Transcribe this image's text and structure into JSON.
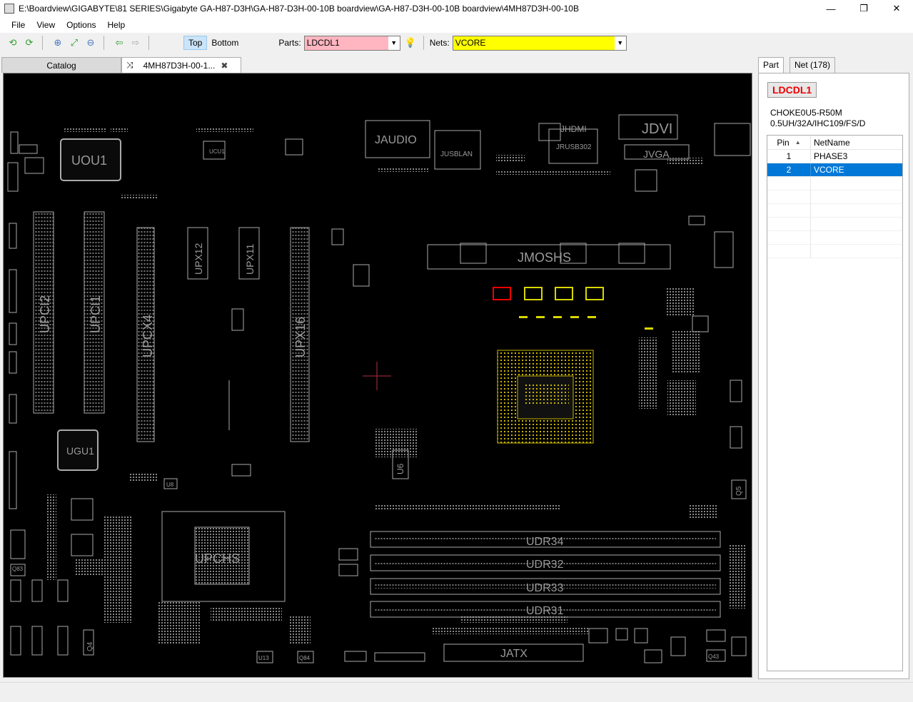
{
  "window": {
    "title": "E:\\Boardview\\GIGABYTE\\81 SERIES\\Gigabyte GA-H87-D3H\\GA-H87-D3H-00-10B boardview\\GA-H87-D3H-00-10B boardview\\4MH87D3H-00-10B",
    "minimize": "—",
    "restore": "❐",
    "close": "✕"
  },
  "menu": [
    "File",
    "View",
    "Options",
    "Help"
  ],
  "toolbar": {
    "top_label": "Top",
    "bottom_label": "Bottom",
    "parts_label": "Parts:",
    "parts_value": "LDCDL1",
    "nets_label": "Nets:",
    "nets_value": "VCORE",
    "parts_color": "#ffb6c1",
    "nets_color": "#ffff00"
  },
  "tabs": {
    "catalog": "Catalog",
    "board": "4MH87D3H-00-1..."
  },
  "board": {
    "labels": [
      "UOU1",
      "UCU1",
      "JAUDIO",
      "JUSBLAN",
      "JRUSB302",
      "JHDMI",
      "JDVI",
      "JVGA",
      "UPCI2",
      "UPCI1",
      "UPCX4",
      "UPX12",
      "UPX11",
      "UPX16",
      "JMOSHS",
      "UGU1",
      "UPCHS",
      "UDR34",
      "UDR32",
      "UDR33",
      "UDR31",
      "JATX",
      "U6",
      "Q5",
      "Q4",
      "Q84",
      "Q43",
      "U8",
      "U13",
      "Q83"
    ]
  },
  "panel": {
    "tab_part": "Part",
    "tab_net": "Net (178)",
    "part_name": "LDCDL1",
    "desc_line1": "CHOKE0U5-R50M",
    "desc_line2": "0.5UH/32A/IHC109/FS/D",
    "col_pin": "Pin",
    "col_net": "NetName",
    "rows": [
      {
        "pin": "1",
        "net": "PHASE3"
      },
      {
        "pin": "2",
        "net": "VCORE"
      }
    ]
  }
}
